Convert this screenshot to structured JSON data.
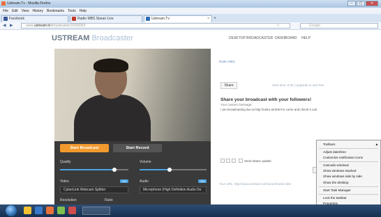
{
  "window": {
    "title": "Ustream.Tv - Mozilla Firefox",
    "buttons": [
      "–",
      "▢",
      "✕"
    ]
  },
  "menubar": [
    "File",
    "Edit",
    "View",
    "History",
    "Bookmarks",
    "Tools",
    "Help"
  ],
  "tabs": [
    {
      "label": "Facebook",
      "icon_color": "#3b5998"
    },
    {
      "label": "Radio MBS Siaran Live",
      "icon_color": "#c0392b"
    },
    {
      "label": "Ustream.Tv",
      "icon_color": "#2d6cb3"
    }
  ],
  "tab_close": "×",
  "newtab": "+",
  "nav": {
    "back": "◀",
    "forward": "▶",
    "url_domain": "ustream.tv",
    "url_prefix": "www.",
    "url_rest": "/broadcaster/10/42053",
    "star": "☆",
    "search_placeholder": "Google"
  },
  "page": {
    "logo_main": "USTREAM",
    "logo_sub": " Broadcaster",
    "topnav": [
      "DESKTOP BROADCASTER",
      "DASHBOARD",
      "HELP"
    ],
    "channel_name": "Radio MBS",
    "tabs_share": "Share",
    "share_meta": "Start time: 0:00  |  Upgrade to ads-free",
    "share_title": "Share your broadcast with your followers!",
    "share_sub": "Your custom message:",
    "share_msg": "I am broadcasting live at http://ustre.am/HkYm come and check it out!",
    "send_status": "Send status update",
    "send_btn": "Sha",
    "url_line": "Your URL: http://www.ustream.tv/channel/radio-mbs",
    "start_broadcast": "Start Broadcast",
    "start_record": "Start Record",
    "quality_label": "Quality",
    "volume_label": "Volume",
    "video_label": "Video",
    "audio_label": "Audio",
    "toggle_on": "ON",
    "video_device": "CyberLink Webcam Splitter",
    "audio_device": "Microphone (High Definition Audio De",
    "resolution_label": "Resolution",
    "ratio_label": "Ratio",
    "quality_level": 0.8,
    "volume_level": 0.45
  },
  "context_menu": {
    "items": [
      {
        "label": "Toolbars",
        "submenu": true
      },
      {
        "sep": true
      },
      {
        "label": "Adjust date/time"
      },
      {
        "label": "Customize notification icons"
      },
      {
        "sep": true
      },
      {
        "label": "Cascade windows"
      },
      {
        "label": "Show windows stacked"
      },
      {
        "label": "Show windows side by side"
      },
      {
        "label": "Show the desktop"
      },
      {
        "sep": true
      },
      {
        "label": "Start Task Manager"
      },
      {
        "sep": true
      },
      {
        "label": "Lock the taskbar"
      },
      {
        "label": "Properties"
      }
    ]
  },
  "taskbar": {
    "icons": [
      "#f1c232",
      "#3a79c9",
      "#e8703a",
      "#7fbf4d",
      "#d04b4b"
    ]
  }
}
